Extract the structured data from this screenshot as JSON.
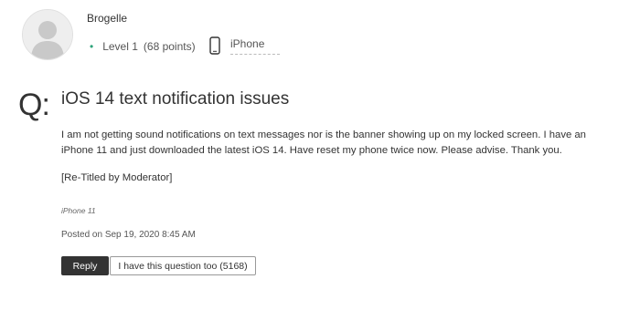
{
  "author": {
    "name": "Brogelle",
    "level": "Level 1",
    "points": "(68 points)",
    "device": "iPhone"
  },
  "question": {
    "marker": "Q:",
    "title": "iOS 14 text notification issues",
    "body_line1": "I am not getting sound notifications on text messages nor is the banner showing up on my locked screen.  I have an",
    "body_line2": "iPhone 11 and just downloaded the latest iOS 14.  Have reset my phone twice now.  Please advise.  Thank you.",
    "moderator_note": "[Re-Titled by Moderator]",
    "device_tag": "iPhone 11",
    "posted": "Posted on Sep 19, 2020 8:45 AM"
  },
  "actions": {
    "reply_label": "Reply",
    "same_question_label": "I have this question too (5168)"
  },
  "colors": {
    "level_bullet": "#2ea37a",
    "reply_bg": "#333333"
  },
  "icons": {
    "avatar": "user-silhouette",
    "device": "phone-icon"
  }
}
